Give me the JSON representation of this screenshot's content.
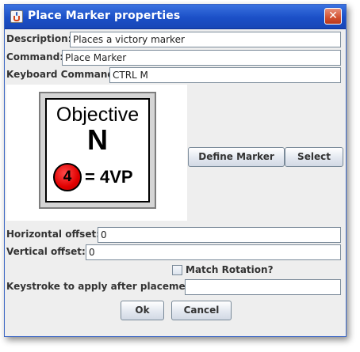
{
  "window": {
    "title": "Place Marker properties"
  },
  "form": {
    "description": {
      "label": "Description:",
      "value": "Places a victory marker"
    },
    "command": {
      "label": "Command:",
      "value": "Place Marker"
    },
    "keyboard_command": {
      "label": "Keyboard Command:",
      "value": "CTRL M"
    },
    "horizontal_offset": {
      "label": "Horizontal offset:",
      "value": "0"
    },
    "vertical_offset": {
      "label": "Vertical offset:",
      "value": "0"
    },
    "match_rotation": {
      "label": "Match Rotation?",
      "checked": false
    },
    "keystroke_after": {
      "label": "Keystroke to apply after placement:",
      "value": ""
    }
  },
  "marker_preview": {
    "heading": "Objective",
    "letter": "N",
    "circle_number": "4",
    "circle_color": "#e00000",
    "value_text": "= 4VP"
  },
  "buttons": {
    "define_marker": "Define Marker",
    "select": "Select",
    "ok": "Ok",
    "cancel": "Cancel"
  },
  "icons": {
    "app": "java-icon",
    "close": "close-icon"
  },
  "colors": {
    "titlebar": "#1b4fc7",
    "close_button": "#d2502f"
  }
}
